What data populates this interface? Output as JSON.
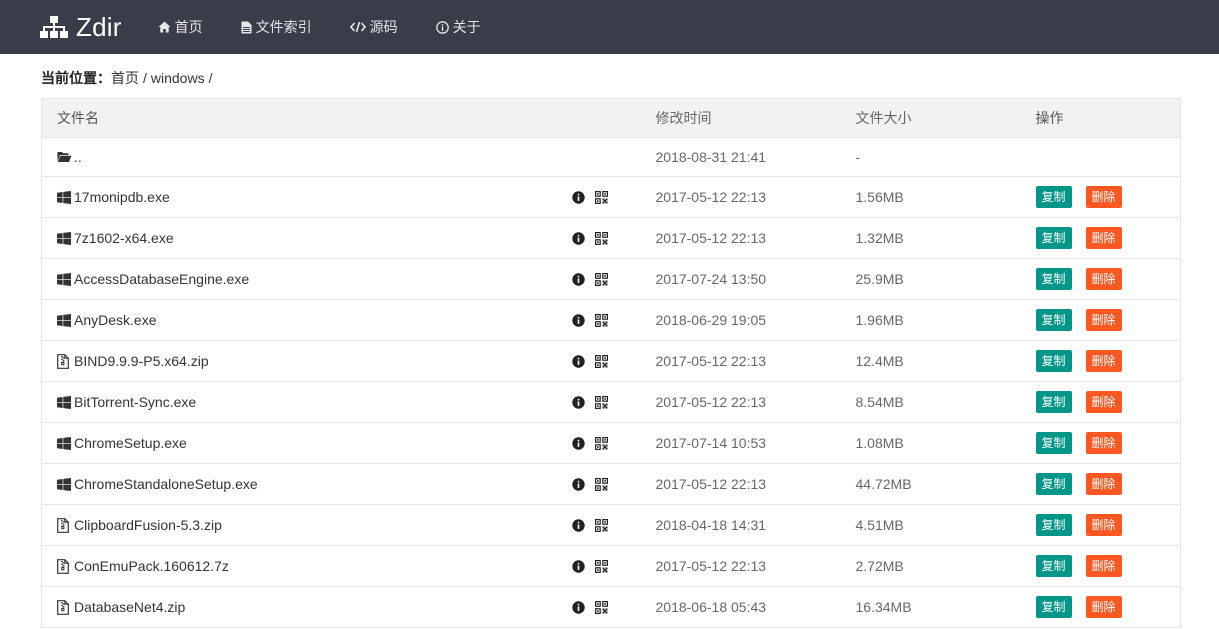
{
  "navbar": {
    "brand": "Zdir",
    "items": [
      {
        "label": "首页",
        "icon": "home-icon"
      },
      {
        "label": "文件索引",
        "icon": "file-icon"
      },
      {
        "label": "源码",
        "icon": "code-icon"
      },
      {
        "label": "关于",
        "icon": "info-icon"
      }
    ]
  },
  "breadcrumb": {
    "label": "当前位置：",
    "home": "首页",
    "sep": "/",
    "folder": "windows",
    "trailing": "/"
  },
  "table": {
    "headers": {
      "name": "文件名",
      "time": "修改时间",
      "size": "文件大小",
      "ops": "操作"
    },
    "parent": {
      "name": "..",
      "time": "2018-08-31 21:41",
      "size": "-"
    },
    "copy_label": "复制",
    "delete_label": "删除",
    "rows": [
      {
        "name": "17monipdb.exe",
        "type": "exe",
        "time": "2017-05-12 22:13",
        "size": "1.56MB"
      },
      {
        "name": "7z1602-x64.exe",
        "type": "exe",
        "time": "2017-05-12 22:13",
        "size": "1.32MB"
      },
      {
        "name": "AccessDatabaseEngine.exe",
        "type": "exe",
        "time": "2017-07-24 13:50",
        "size": "25.9MB"
      },
      {
        "name": "AnyDesk.exe",
        "type": "exe",
        "time": "2018-06-29 19:05",
        "size": "1.96MB"
      },
      {
        "name": "BIND9.9.9-P5.x64.zip",
        "type": "zip",
        "time": "2017-05-12 22:13",
        "size": "12.4MB"
      },
      {
        "name": "BitTorrent-Sync.exe",
        "type": "exe",
        "time": "2017-05-12 22:13",
        "size": "8.54MB"
      },
      {
        "name": "ChromeSetup.exe",
        "type": "exe",
        "time": "2017-07-14 10:53",
        "size": "1.08MB"
      },
      {
        "name": "ChromeStandaloneSetup.exe",
        "type": "exe",
        "time": "2017-05-12 22:13",
        "size": "44.72MB"
      },
      {
        "name": "ClipboardFusion-5.3.zip",
        "type": "zip",
        "time": "2018-04-18 14:31",
        "size": "4.51MB"
      },
      {
        "name": "ConEmuPack.160612.7z",
        "type": "zip",
        "time": "2017-05-12 22:13",
        "size": "2.72MB"
      },
      {
        "name": "DatabaseNet4.zip",
        "type": "zip",
        "time": "2018-06-18 05:43",
        "size": "16.34MB"
      }
    ]
  },
  "colors": {
    "navbar_bg": "#393d49",
    "copy_button": "#009688",
    "delete_button": "#ff5722",
    "header_bg": "#f2f2f2"
  }
}
